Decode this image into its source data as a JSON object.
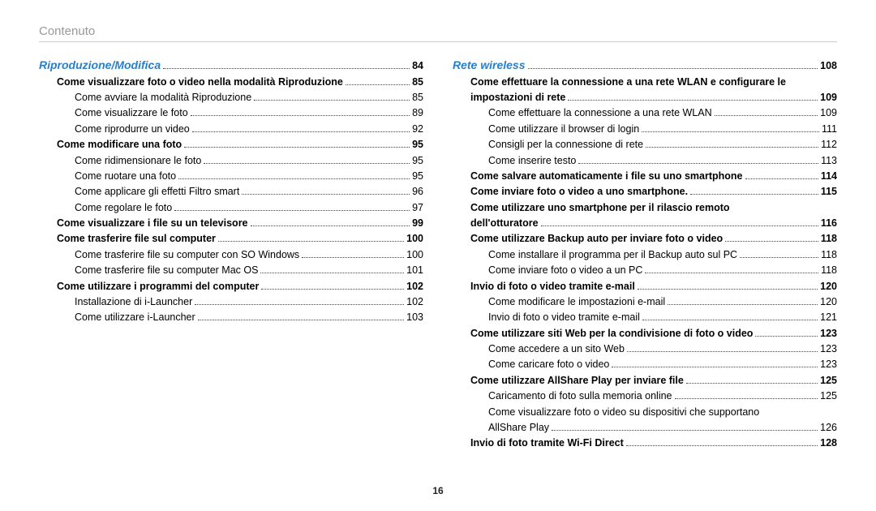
{
  "header": "Contenuto",
  "page_number": "16",
  "chart_data": null,
  "left": {
    "section": "Riproduzione/Modifica",
    "section_page": "84",
    "items": [
      {
        "label": "Come visualizzare foto o video nella modalità Riproduzione",
        "page": "85",
        "level": 1,
        "bold": true
      },
      {
        "label": "Come avviare la modalità Riproduzione",
        "page": "85",
        "level": 2,
        "bold": false
      },
      {
        "label": "Come visualizzare le foto",
        "page": "89",
        "level": 2,
        "bold": false
      },
      {
        "label": "Come riprodurre un video",
        "page": "92",
        "level": 2,
        "bold": false
      },
      {
        "label": "Come modificare una foto",
        "page": "95",
        "level": 1,
        "bold": true
      },
      {
        "label": "Come ridimensionare le foto",
        "page": "95",
        "level": 2,
        "bold": false
      },
      {
        "label": "Come ruotare una foto",
        "page": "95",
        "level": 2,
        "bold": false
      },
      {
        "label": "Come applicare gli effetti Filtro smart",
        "page": "96",
        "level": 2,
        "bold": false
      },
      {
        "label": "Come regolare le foto",
        "page": "97",
        "level": 2,
        "bold": false
      },
      {
        "label": "Come visualizzare i file su un televisore",
        "page": "99",
        "level": 1,
        "bold": true
      },
      {
        "label": "Come trasferire file sul computer",
        "page": "100",
        "level": 1,
        "bold": true
      },
      {
        "label": "Come trasferire file su computer con SO Windows",
        "page": "100",
        "level": 2,
        "bold": false
      },
      {
        "label": "Come trasferire file su computer Mac OS",
        "page": "101",
        "level": 2,
        "bold": false
      },
      {
        "label": "Come utilizzare i programmi del computer",
        "page": "102",
        "level": 1,
        "bold": true
      },
      {
        "label": "Installazione di i-Launcher",
        "page": "102",
        "level": 2,
        "bold": false
      },
      {
        "label": "Come utilizzare i-Launcher",
        "page": "103",
        "level": 2,
        "bold": false
      }
    ]
  },
  "right": {
    "section": "Rete wireless",
    "section_page": "108",
    "items": [
      {
        "label": "Come effettuare la connessione a una rete WLAN e configurare le",
        "page": "",
        "level": 1,
        "bold": true
      },
      {
        "label": "impostazioni di rete",
        "page": "109",
        "level": 1,
        "bold": true
      },
      {
        "label": "Come effettuare la connessione a una rete WLAN",
        "page": "109",
        "level": 2,
        "bold": false
      },
      {
        "label": "Come utilizzare il browser di login",
        "page": "111",
        "level": 2,
        "bold": false
      },
      {
        "label": "Consigli per la connessione di rete",
        "page": "112",
        "level": 2,
        "bold": false
      },
      {
        "label": "Come inserire testo",
        "page": "113",
        "level": 2,
        "bold": false
      },
      {
        "label": "Come salvare automaticamente i file su uno smartphone",
        "page": "114",
        "level": 1,
        "bold": true
      },
      {
        "label": "Come inviare foto o video a uno smartphone.",
        "page": "115",
        "level": 1,
        "bold": true
      },
      {
        "label": "Come utilizzare uno smartphone per il rilascio remoto",
        "page": "",
        "level": 1,
        "bold": true
      },
      {
        "label": "dell'otturatore",
        "page": "116",
        "level": 1,
        "bold": true
      },
      {
        "label": "Come utilizzare Backup auto per inviare foto o video",
        "page": "118",
        "level": 1,
        "bold": true
      },
      {
        "label": "Come installare il programma per il Backup auto sul PC",
        "page": "118",
        "level": 2,
        "bold": false
      },
      {
        "label": "Come inviare foto o video a un PC",
        "page": "118",
        "level": 2,
        "bold": false
      },
      {
        "label": "Invio di foto o video tramite e-mail",
        "page": "120",
        "level": 1,
        "bold": true
      },
      {
        "label": "Come modificare le impostazioni e-mail",
        "page": "120",
        "level": 2,
        "bold": false
      },
      {
        "label": "Invio di foto o video tramite e-mail",
        "page": "121",
        "level": 2,
        "bold": false
      },
      {
        "label": "Come utilizzare siti Web per la condivisione di foto o video",
        "page": "123",
        "level": 1,
        "bold": true
      },
      {
        "label": "Come accedere a un sito Web",
        "page": "123",
        "level": 2,
        "bold": false
      },
      {
        "label": "Come caricare foto o video",
        "page": "123",
        "level": 2,
        "bold": false
      },
      {
        "label": "Come utilizzare AllShare Play per inviare file",
        "page": "125",
        "level": 1,
        "bold": true
      },
      {
        "label": "Caricamento di foto sulla memoria online",
        "page": "125",
        "level": 2,
        "bold": false
      },
      {
        "label": "Come visualizzare foto o video su dispositivi che supportano",
        "page": "",
        "level": 2,
        "bold": false
      },
      {
        "label": "AllShare Play",
        "page": "126",
        "level": 2,
        "bold": false
      },
      {
        "label": "Invio di foto tramite Wi-Fi Direct",
        "page": "128",
        "level": 1,
        "bold": true
      }
    ]
  }
}
